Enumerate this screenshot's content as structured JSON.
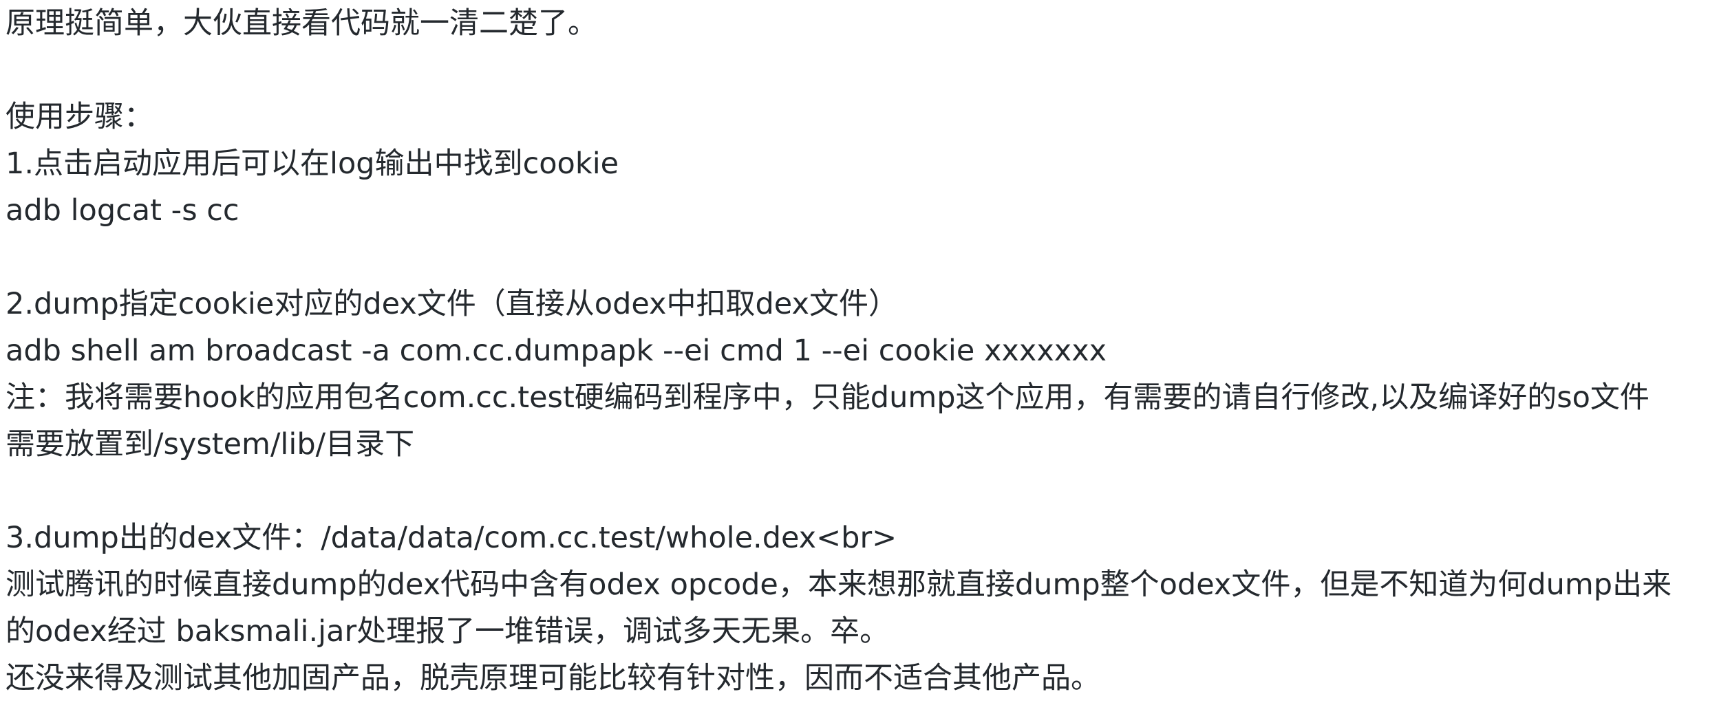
{
  "document": {
    "lines": [
      "原理挺简单，大伙直接看代码就一清二楚了。",
      "使用步骤：",
      "1.点击启动应用后可以在log输出中找到cookie",
      "adb logcat -s cc",
      "2.dump指定cookie对应的dex文件（直接从odex中扣取dex文件）",
      "adb shell am broadcast -a com.cc.dumpapk --ei cmd 1 --ei cookie xxxxxxx",
      "注：我将需要hook的应用包名com.cc.test硬编码到程序中，只能dump这个应用，有需要的请自行修改,以及编译好的so文件",
      "需要放置到/system/lib/目录下",
      "3.dump出的dex文件：/data/data/com.cc.test/whole.dex<br>",
      "测试腾讯的时候直接dump的dex代码中含有odex opcode，本来想那就直接dump整个odex文件，但是不知道为何dump出来",
      "的odex经过 baksmali.jar处理报了一堆错误，调试多天无果。卒。",
      "还没来得及测试其他加固产品，脱壳原理可能比较有针对性，因而不适合其他产品。"
    ]
  }
}
